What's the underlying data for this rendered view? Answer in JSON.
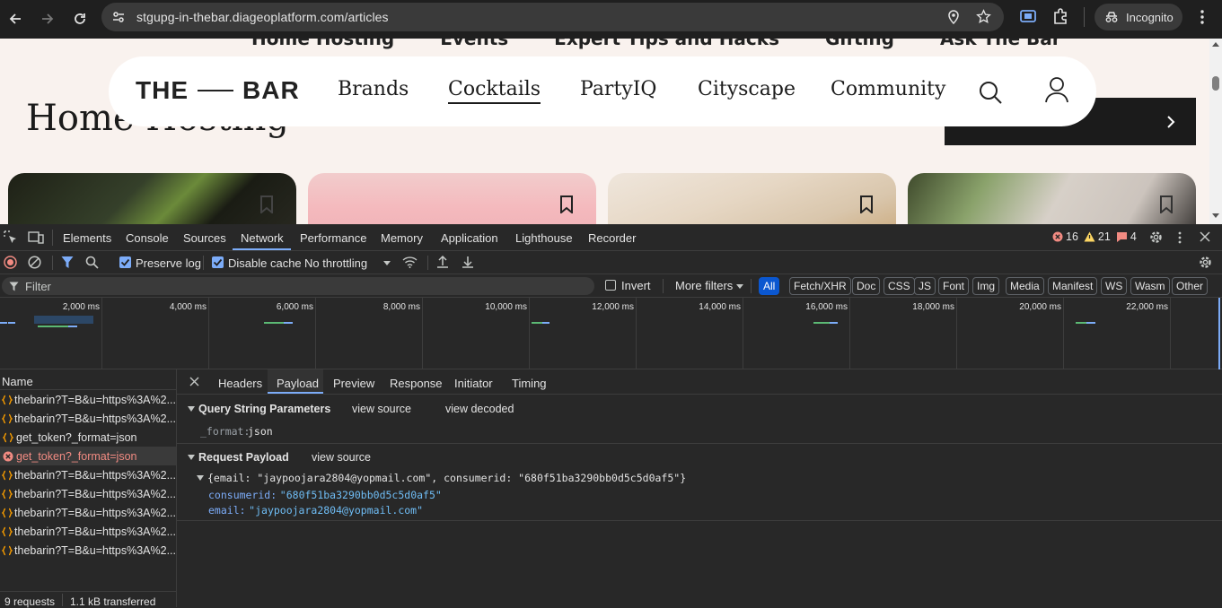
{
  "browser": {
    "url": "stgupg-in-thebar.diageoplatform.com/articles",
    "incognito_label": "Incognito"
  },
  "page": {
    "behind_nav": [
      "Home Hosting",
      "Events",
      "Expert Tips and Hacks",
      "Gifting",
      "Ask The Bar"
    ],
    "logo_left": "THE",
    "logo_right": "BAR",
    "nav": {
      "brands": "Brands",
      "cocktails": "Cocktails",
      "partyiq": "PartyIQ",
      "cityscape": "Cityscape",
      "community": "Community"
    },
    "heading": "Home Hosting"
  },
  "devtools": {
    "tabs": [
      "Elements",
      "Console",
      "Sources",
      "Network",
      "Performance",
      "Memory",
      "Application",
      "Lighthouse",
      "Recorder"
    ],
    "active_tab": "Network",
    "errors": "16",
    "warnings": "21",
    "issues": "4",
    "toolbar": {
      "preserve_log": "Preserve log",
      "disable_cache": "Disable cache",
      "throttling": "No throttling"
    },
    "filter": {
      "placeholder": "Filter",
      "invert": "Invert",
      "more_filters": "More filters",
      "types": [
        "All",
        "Fetch/XHR",
        "Doc",
        "CSS",
        "JS",
        "Font",
        "Img",
        "Media",
        "Manifest",
        "WS",
        "Wasm",
        "Other"
      ]
    },
    "overview_ticks": [
      "2,000 ms",
      "4,000 ms",
      "6,000 ms",
      "8,000 ms",
      "10,000 ms",
      "12,000 ms",
      "14,000 ms",
      "16,000 ms",
      "18,000 ms",
      "20,000 ms",
      "22,000 ms"
    ],
    "name_header": "Name",
    "requests": [
      {
        "name": "thebarin?T=B&u=https%3A%2...",
        "error": false
      },
      {
        "name": "thebarin?T=B&u=https%3A%2...",
        "error": false
      },
      {
        "name": "get_token?_format=json",
        "error": false
      },
      {
        "name": "get_token?_format=json",
        "error": true
      },
      {
        "name": "thebarin?T=B&u=https%3A%2...",
        "error": false
      },
      {
        "name": "thebarin?T=B&u=https%3A%2...",
        "error": false
      },
      {
        "name": "thebarin?T=B&u=https%3A%2...",
        "error": false
      },
      {
        "name": "thebarin?T=B&u=https%3A%2...",
        "error": false
      },
      {
        "name": "thebarin?T=B&u=https%3A%2...",
        "error": false
      }
    ],
    "summary": {
      "requests": "9 requests",
      "transferred": "1.1 kB transferred"
    },
    "detail_tabs": [
      "Headers",
      "Payload",
      "Preview",
      "Response",
      "Initiator",
      "Timing"
    ],
    "active_detail_tab": "Payload",
    "query": {
      "title": "Query String Parameters",
      "view_source": "view source",
      "view_decoded": "view decoded",
      "key": "_format:",
      "value": "json"
    },
    "payload": {
      "title": "Request Payload",
      "view_source": "view source",
      "summary": "{email: \"jaypoojara2804@yopmail.com\", consumerid: \"680f51ba3290bb0d5c5d0af5\"}",
      "consumerid_key": "consumerid:",
      "consumerid_value": "\"680f51ba3290bb0d5c5d0af5\"",
      "email_key": "email:",
      "email_value": "\"jaypoojara2804@yopmail.com\""
    }
  },
  "colors": {
    "accent": "#7cacf8",
    "error": "#f28b82",
    "warning": "#fdd663",
    "string": "#6fbdf5"
  }
}
